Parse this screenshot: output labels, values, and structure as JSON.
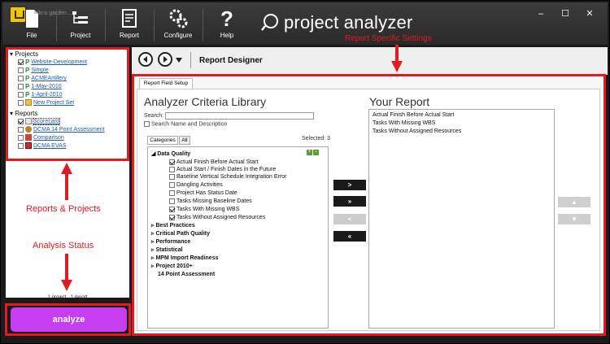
{
  "toolbar": {
    "quick_access_text": "Hallo'a garden…",
    "buttons": [
      {
        "label": "File",
        "icon": "file-icon"
      },
      {
        "label": "Project",
        "icon": "project-icon"
      },
      {
        "label": "Report",
        "icon": "report-icon"
      },
      {
        "label": "Configure",
        "icon": "gears-icon"
      },
      {
        "label": "Help",
        "icon": "question-icon"
      }
    ],
    "brand": "project analyzer"
  },
  "window_controls": {
    "minimize": "–",
    "maximize": "☐",
    "close": "✕"
  },
  "annotations": {
    "report_specific": "Report Specific Settings",
    "reports_projects": "Reports & Projects",
    "analysis_status": "Analysis Status",
    "red": "#e21b23"
  },
  "sidebar": {
    "projects_header": "Projects",
    "projects": [
      {
        "label": "Website-Development",
        "checked": true,
        "icon": "p"
      },
      {
        "label": "Simple",
        "checked": false,
        "icon": "p"
      },
      {
        "label": "ACMEArtillery",
        "checked": false,
        "icon": "p"
      },
      {
        "label": "1-May-2010",
        "checked": false,
        "icon": "p"
      },
      {
        "label": "1-April-2010",
        "checked": false,
        "icon": "p"
      },
      {
        "label": "New Project Set",
        "checked": false,
        "icon": "folder"
      }
    ],
    "reports_header": "Reports",
    "reports": [
      {
        "label": "Scorecard",
        "checked": true
      },
      {
        "label": "DCMA 14 Point Assessment",
        "checked": false
      },
      {
        "label": "Comparison",
        "checked": false
      },
      {
        "label": "DCMA EVAS",
        "checked": false
      }
    ],
    "status": "1 project , 1 report",
    "analyze_label": "analyze",
    "analyze_color": "#c53ef0"
  },
  "nav": {
    "title": "Report Designer"
  },
  "designer": {
    "tab": "Report Field Setup",
    "library_title": "Analyzer Criteria Library",
    "search_label": "Search:",
    "search_value": "",
    "search_desc": "Search Name and Description",
    "tab_categories": "Categories",
    "tab_all": "All",
    "selected": "Selected: 3",
    "group_data_quality": "Data Quality",
    "criteria": [
      {
        "label": "Actual Finish Before Actual Start",
        "checked": true
      },
      {
        "label": "Actual Start / Finish Dates in the Future",
        "checked": false
      },
      {
        "label": "Baseline Vertical Schedule Integration Error",
        "checked": false
      },
      {
        "label": "Dangling Activities",
        "checked": false
      },
      {
        "label": "Project Has Status Date",
        "checked": false
      },
      {
        "label": "Tasks Missing Baseline Dates",
        "checked": false
      },
      {
        "label": "Tasks With Missing WBS",
        "checked": true
      },
      {
        "label": "Tasks Without Assigned Resources",
        "checked": true
      }
    ],
    "groups": [
      "Best Practices",
      "Critical Path Quality",
      "Performance",
      "Statistical",
      "MPM Import Readiness",
      "Project 2010+",
      "14 Point Assessment"
    ],
    "move_buttons": [
      ">",
      "»",
      "<",
      "«"
    ],
    "your_report_title": "Your Report",
    "your_report": [
      "Actual Finish Before Actual Start",
      "Tasks With Missing WBS",
      "Tasks Without Assigned Resources"
    ],
    "order_buttons": [
      "▲",
      "▼"
    ]
  }
}
